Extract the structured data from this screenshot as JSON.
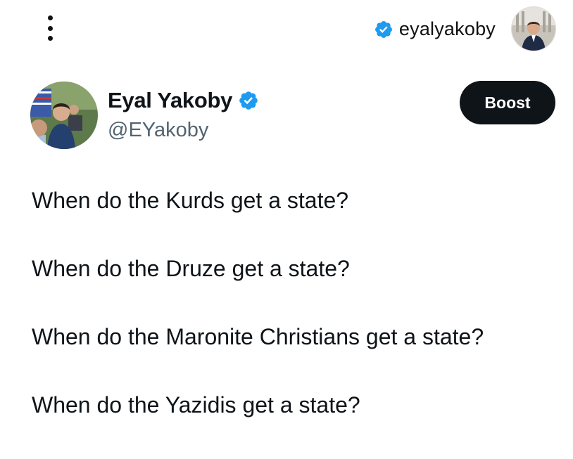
{
  "header": {
    "menu_icon": "more-vertical-icon",
    "account_username": "eyalyakoby",
    "verified_icon": "verified-badge-icon"
  },
  "tweet": {
    "author_name": "Eyal Yakoby",
    "author_handle": "@EYakoby",
    "boost_label": "Boost",
    "lines": [
      "When do the Kurds get a state?",
      "When do the Druze get a state?",
      "When do the Maronite Christians get a state?",
      "When do the Yazidis get a state?"
    ]
  },
  "colors": {
    "verified_blue": "#1d9bf0",
    "text": "#0f1419",
    "secondary_text": "#536471",
    "button_bg": "#0f1419"
  }
}
